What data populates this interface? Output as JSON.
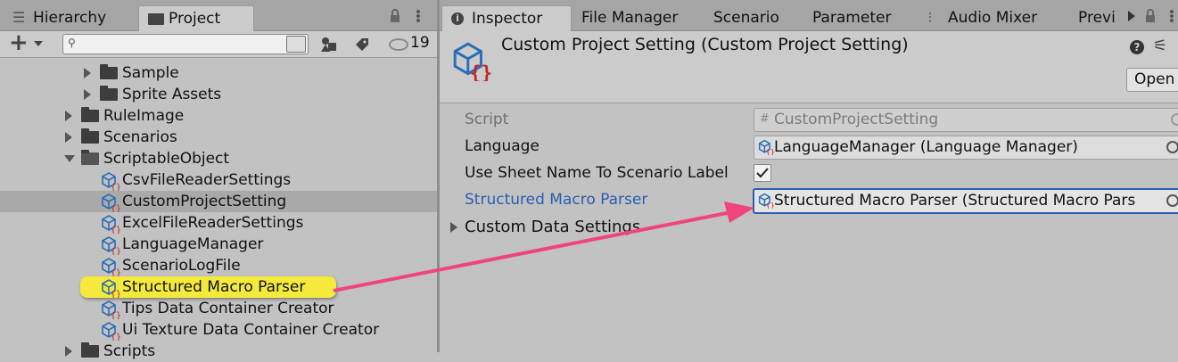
{
  "left_tabs": {
    "hierarchy": "Hierarchy",
    "project": "Project"
  },
  "toolbar": {
    "add_label": "+",
    "search_placeholder": "",
    "visible_count": "19"
  },
  "tree": [
    {
      "label": "Sample",
      "icon": "folder-icon",
      "expand": "collapsed"
    },
    {
      "label": "Sprite Assets",
      "icon": "folder-icon",
      "expand": "collapsed"
    },
    {
      "label": "RuleImage",
      "icon": "folder-icon",
      "expand": "collapsed"
    },
    {
      "label": "Scenarios",
      "icon": "folder-icon",
      "expand": "collapsed"
    },
    {
      "label": "ScriptableObject",
      "icon": "folder-open-icon",
      "expand": "expanded"
    },
    {
      "label": "CsvFileReaderSettings",
      "icon": "scriptable-object-icon"
    },
    {
      "label": "CustomProjectSetting",
      "icon": "scriptable-object-icon",
      "selected": true
    },
    {
      "label": "ExcelFileReaderSettings",
      "icon": "scriptable-object-icon"
    },
    {
      "label": "LanguageManager",
      "icon": "scriptable-object-icon"
    },
    {
      "label": "ScenarioLogFile",
      "icon": "scriptable-object-icon"
    },
    {
      "label": "Structured Macro Parser",
      "icon": "scriptable-object-icon",
      "highlighted": true
    },
    {
      "label": "Tips Data Container Creator",
      "icon": "scriptable-object-icon"
    },
    {
      "label": "Ui Texture Data Container Creator",
      "icon": "scriptable-object-icon"
    },
    {
      "label": "Scripts",
      "icon": "folder-icon",
      "expand": "collapsed"
    }
  ],
  "right_tabs": [
    "Inspector",
    "File Manager",
    "Scenario",
    "Parameter",
    "Audio Mixer",
    "Previ"
  ],
  "inspector": {
    "title": "Custom Project Setting (Custom Project Setting)",
    "open_button": "Open",
    "fields": [
      {
        "label": "Script",
        "value": "CustomProjectSetting",
        "disabled": true
      },
      {
        "label": "Language",
        "value": "LanguageManager (Language Manager)"
      },
      {
        "label": "Use Sheet Name To Scenario Label",
        "checked": true
      },
      {
        "label": "Structured Macro Parser",
        "value": "Structured Macro Parser (Structured Macro Pars",
        "focused": true
      }
    ],
    "foldout": "Custom Data Settings"
  },
  "colors": {
    "accent_arrow": "#f0457a",
    "highlight_yellow": "#f5e93a",
    "focus_blue": "#2a5db0"
  }
}
